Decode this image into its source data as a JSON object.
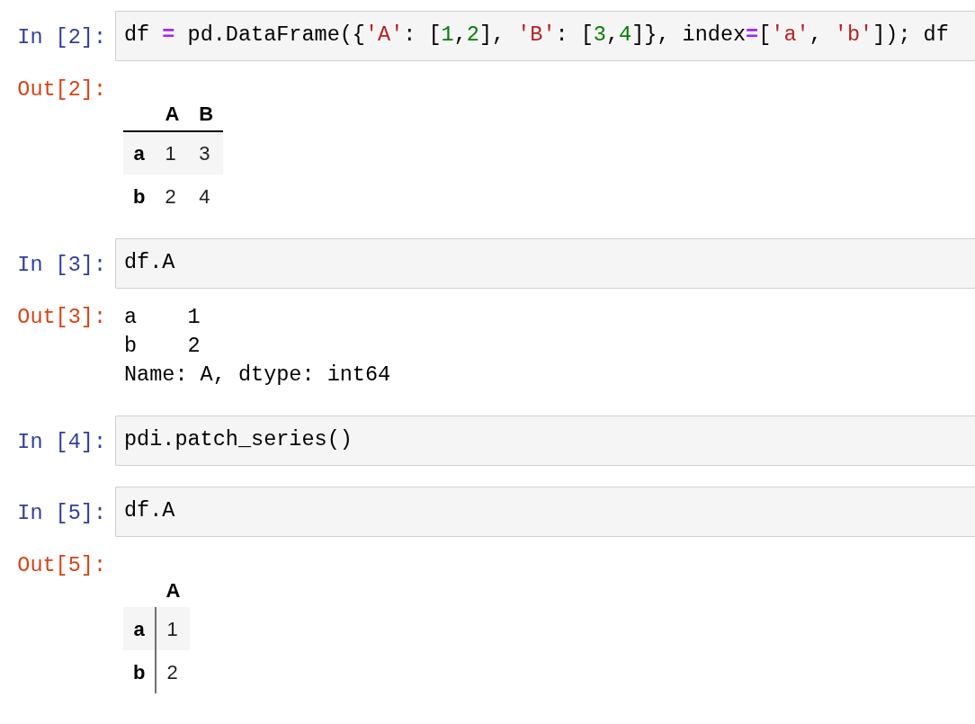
{
  "cells": [
    {
      "in_prompt": "In [2]:",
      "code": [
        {
          "kind": "plain",
          "text": "df "
        },
        {
          "kind": "op",
          "text": "="
        },
        {
          "kind": "plain",
          "text": " pd.DataFrame({"
        },
        {
          "kind": "string",
          "text": "'A'"
        },
        {
          "kind": "plain",
          "text": ": ["
        },
        {
          "kind": "number",
          "text": "1"
        },
        {
          "kind": "plain",
          "text": ","
        },
        {
          "kind": "number",
          "text": "2"
        },
        {
          "kind": "plain",
          "text": "], "
        },
        {
          "kind": "string",
          "text": "'B'"
        },
        {
          "kind": "plain",
          "text": ": ["
        },
        {
          "kind": "number",
          "text": "3"
        },
        {
          "kind": "plain",
          "text": ","
        },
        {
          "kind": "number",
          "text": "4"
        },
        {
          "kind": "plain",
          "text": "]}, index"
        },
        {
          "kind": "op",
          "text": "="
        },
        {
          "kind": "plain",
          "text": "["
        },
        {
          "kind": "string",
          "text": "'a'"
        },
        {
          "kind": "plain",
          "text": ", "
        },
        {
          "kind": "string",
          "text": "'b'"
        },
        {
          "kind": "plain",
          "text": "]); df"
        }
      ],
      "output": {
        "out_prompt": "Out[2]:",
        "kind": "table",
        "header_rule": true,
        "index_divider": false,
        "columns": [
          "A",
          "B"
        ],
        "rows": [
          {
            "index": "a",
            "values": [
              "1",
              "3"
            ]
          },
          {
            "index": "b",
            "values": [
              "2",
              "4"
            ]
          }
        ]
      }
    },
    {
      "in_prompt": "In [3]:",
      "code": [
        {
          "kind": "plain",
          "text": "df.A"
        }
      ],
      "output": {
        "out_prompt": "Out[3]:",
        "kind": "text",
        "lines": [
          "a    1",
          "b    2",
          "Name: A, dtype: int64"
        ]
      }
    },
    {
      "in_prompt": "In [4]:",
      "code": [
        {
          "kind": "plain",
          "text": "pdi.patch_series()"
        }
      ]
    },
    {
      "in_prompt": "In [5]:",
      "code": [
        {
          "kind": "plain",
          "text": "df.A"
        }
      ],
      "output": {
        "out_prompt": "Out[5]:",
        "kind": "table",
        "header_rule": false,
        "index_divider": true,
        "columns": [
          "A"
        ],
        "rows": [
          {
            "index": "a",
            "values": [
              "1"
            ]
          },
          {
            "index": "b",
            "values": [
              "2"
            ]
          }
        ]
      }
    }
  ]
}
